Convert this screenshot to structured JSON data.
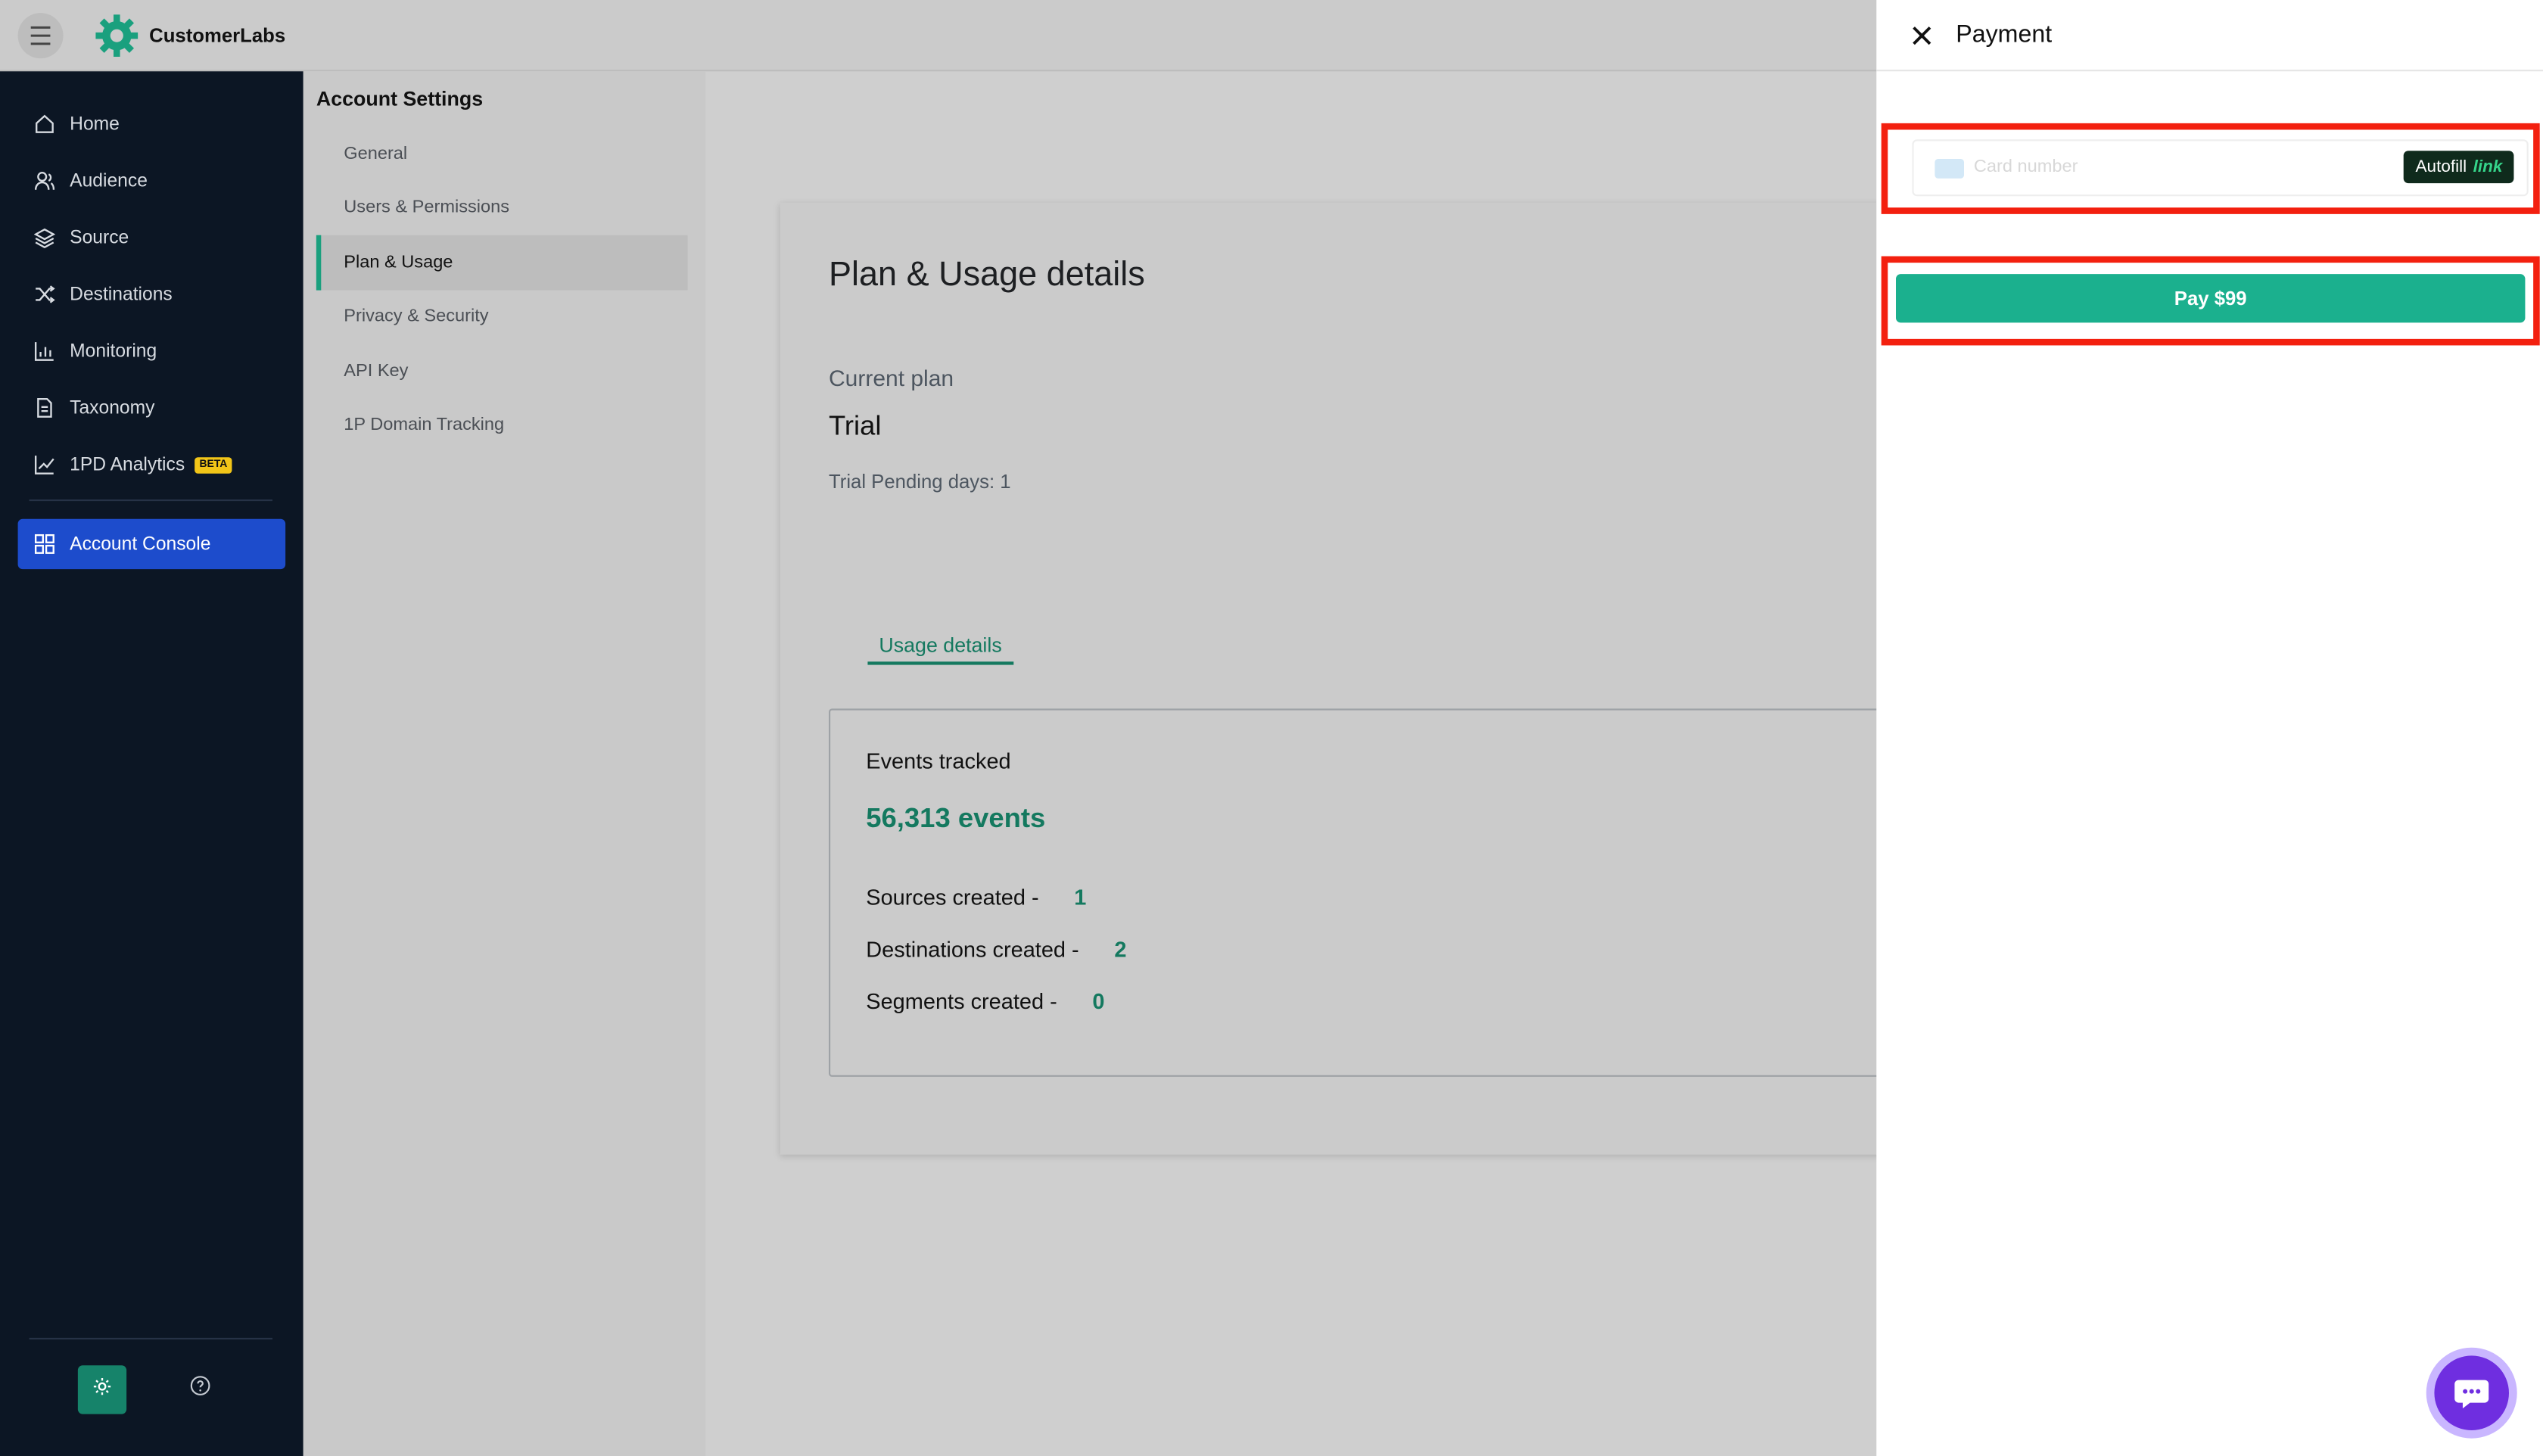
{
  "app": {
    "brand": "CustomerLabs"
  },
  "sidebar": {
    "items": [
      {
        "label": "Home",
        "icon": "home-icon"
      },
      {
        "label": "Audience",
        "icon": "audience-icon"
      },
      {
        "label": "Source",
        "icon": "layers-icon"
      },
      {
        "label": "Destinations",
        "icon": "shuffle-icon"
      },
      {
        "label": "Monitoring",
        "icon": "chart-icon"
      },
      {
        "label": "Taxonomy",
        "icon": "document-icon"
      },
      {
        "label": "1PD Analytics",
        "icon": "trend-icon",
        "badge": "BETA"
      },
      {
        "label": "Account Console",
        "icon": "grid-icon",
        "active": true
      }
    ]
  },
  "settings": {
    "title": "Account Settings",
    "items": [
      {
        "label": "General"
      },
      {
        "label": "Users & Permissions"
      },
      {
        "label": "Plan & Usage",
        "active": true
      },
      {
        "label": "Privacy & Security"
      },
      {
        "label": "API Key"
      },
      {
        "label": "1P Domain Tracking"
      }
    ]
  },
  "plan": {
    "title": "Plan & Usage details",
    "current_plan_label": "Current plan",
    "current_plan_value": "Trial",
    "trial_days": "Trial Pending days: 1",
    "tab_label": "Usage details",
    "events_label": "Events tracked",
    "events_value": "56,313 events",
    "stats": [
      {
        "label": "Sources created -",
        "value": "1"
      },
      {
        "label": "Destinations created -",
        "value": "2"
      },
      {
        "label": "Segments created -",
        "value": "0"
      }
    ]
  },
  "payment": {
    "title": "Payment",
    "card_placeholder": "Card number",
    "autofill_label": "Autofill",
    "autofill_link": "link",
    "pay_label": "Pay $99"
  },
  "colors": {
    "accent": "#1bb08e",
    "sidebar_bg": "#0c1624",
    "active_nav": "#1d4ccc",
    "highlight": "#f3200f",
    "chat": "#6f2ee0"
  }
}
